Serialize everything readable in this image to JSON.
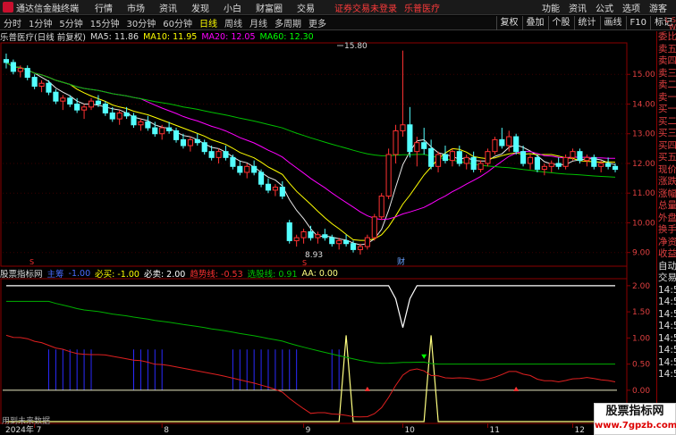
{
  "titlebar": {
    "app_title": "通达信金融终端",
    "menus": [
      "行情",
      "市场",
      "资讯",
      "发现",
      "小白",
      "财富圈",
      "交易"
    ],
    "login_notice": "证券交易未登录",
    "stock_name": "乐普医疗",
    "right_items": [
      "功能",
      "资讯",
      "公式",
      "选项"
    ],
    "user": "游客"
  },
  "toolbar": {
    "periods": [
      "分时",
      "1分钟",
      "5分钟",
      "15分钟",
      "30分钟",
      "60分钟",
      "日线",
      "周线",
      "月线",
      "多周期",
      "更多"
    ],
    "active_period": "日线",
    "buttons": [
      "复权",
      "叠加",
      "个股",
      "统计",
      "画线",
      "F10",
      "标记"
    ]
  },
  "chart_header": {
    "title": "乐普医疗(日线 前复权)",
    "ma5": "MA5: 11.86",
    "ma10": "MA10: 11.95",
    "ma20": "MA20: 12.05",
    "ma60": "MA60: 12.30"
  },
  "indicator_header": {
    "name": "股票指标网",
    "item1": "主筹",
    "item1_val": "-1.00",
    "item2": "必买: -1.00",
    "item3": "必卖: 2.00",
    "item4": "趋势线: -0.53",
    "item5": "选股线: 0.91",
    "item6": "AA: 0.00"
  },
  "price_labels": [
    "15.00",
    "14.00",
    "13.00",
    "12.00",
    "11.00",
    "10.00",
    "9.00"
  ],
  "indicator_labels": [
    "2.00",
    "1.50",
    "1.00",
    "0.50",
    "0.00",
    "-0.50"
  ],
  "annotations": {
    "high": "15.80",
    "low": "8.93",
    "cai": "财",
    "s_marker": "S"
  },
  "date_axis": [
    "2024年",
    "7",
    "8",
    "9",
    "10",
    "11",
    "12"
  ],
  "bottom_label": "用到未来数据",
  "right_panel": {
    "items": [
      "委比",
      "卖五",
      "卖四",
      "卖三",
      "卖二",
      "卖一",
      "买一",
      "买二",
      "买三",
      "买四",
      "买五",
      "现价",
      "涨跌",
      "涨幅",
      "总量",
      "外盘",
      "换手",
      "净资",
      "收益",
      "自动",
      "交易",
      "14:50",
      "14:50",
      "14:50",
      "14:50",
      "14:50",
      "14:50",
      "14:50",
      "14:50"
    ],
    "tag": "L S W"
  },
  "watermark": {
    "line1": "股票指标网",
    "line2": "www.7gpzb.com"
  },
  "chart_data": {
    "type": "line",
    "price_axis": {
      "ylim": [
        8.6,
        16.0
      ],
      "ticks": [
        9,
        10,
        11,
        12,
        13,
        14,
        15
      ]
    },
    "indicator_axis": {
      "ylim": [
        -0.6,
        2.1
      ],
      "ticks": [
        2.0,
        1.5,
        1.0,
        0.5,
        0.0,
        -0.5
      ]
    },
    "candles": [
      [
        15.5,
        15.7,
        15.2,
        15.4
      ],
      [
        15.4,
        15.5,
        15.0,
        15.1
      ],
      [
        15.1,
        15.3,
        14.9,
        15.2
      ],
      [
        15.2,
        15.3,
        14.8,
        14.9
      ],
      [
        14.9,
        15.0,
        14.5,
        14.6
      ],
      [
        14.6,
        14.8,
        14.4,
        14.7
      ],
      [
        14.7,
        14.8,
        14.3,
        14.4
      ],
      [
        14.4,
        14.5,
        14.0,
        14.1
      ],
      [
        14.1,
        14.3,
        13.8,
        14.2
      ],
      [
        14.2,
        14.3,
        13.9,
        14.0
      ],
      [
        14.0,
        14.2,
        13.7,
        13.8
      ],
      [
        13.8,
        14.0,
        13.5,
        13.9
      ],
      [
        13.9,
        14.2,
        13.8,
        14.1
      ],
      [
        14.1,
        14.3,
        13.9,
        14.0
      ],
      [
        14.0,
        14.1,
        13.6,
        13.7
      ],
      [
        13.7,
        13.9,
        13.4,
        13.5
      ],
      [
        13.5,
        13.8,
        13.3,
        13.7
      ],
      [
        13.7,
        13.9,
        13.5,
        13.6
      ],
      [
        13.6,
        13.7,
        13.2,
        13.3
      ],
      [
        13.3,
        13.5,
        13.1,
        13.4
      ],
      [
        13.4,
        13.6,
        13.1,
        13.2
      ],
      [
        13.2,
        13.4,
        12.9,
        13.0
      ],
      [
        13.0,
        13.3,
        12.8,
        13.2
      ],
      [
        13.2,
        13.4,
        13.0,
        13.1
      ],
      [
        13.1,
        13.2,
        12.7,
        12.8
      ],
      [
        12.8,
        13.0,
        12.5,
        12.6
      ],
      [
        12.6,
        12.9,
        12.4,
        12.8
      ],
      [
        12.8,
        13.0,
        12.6,
        12.7
      ],
      [
        12.7,
        12.8,
        12.3,
        12.4
      ],
      [
        12.4,
        12.6,
        12.1,
        12.2
      ],
      [
        12.2,
        12.5,
        12.0,
        12.4
      ],
      [
        12.4,
        12.6,
        12.1,
        12.2
      ],
      [
        12.2,
        12.3,
        11.8,
        11.9
      ],
      [
        11.9,
        12.1,
        11.6,
        11.7
      ],
      [
        11.7,
        12.0,
        11.5,
        11.9
      ],
      [
        11.9,
        12.1,
        11.6,
        11.7
      ],
      [
        11.7,
        11.8,
        11.2,
        11.3
      ],
      [
        11.3,
        11.5,
        11.0,
        11.1
      ],
      [
        11.1,
        11.3,
        10.9,
        11.2
      ],
      [
        11.2,
        11.4,
        10.8,
        10.9
      ],
      [
        10.0,
        10.1,
        9.3,
        9.4
      ],
      [
        9.4,
        9.6,
        9.2,
        9.5
      ],
      [
        9.5,
        9.8,
        9.3,
        9.7
      ],
      [
        9.7,
        9.9,
        9.4,
        9.5
      ],
      [
        9.5,
        9.7,
        9.3,
        9.6
      ],
      [
        9.6,
        9.8,
        9.4,
        9.5
      ],
      [
        9.5,
        9.6,
        9.2,
        9.3
      ],
      [
        9.3,
        9.5,
        9.1,
        9.4
      ],
      [
        9.4,
        9.6,
        9.2,
        9.3
      ],
      [
        9.3,
        9.4,
        9.0,
        9.1
      ],
      [
        9.1,
        9.3,
        8.93,
        9.2
      ],
      [
        9.2,
        9.6,
        9.1,
        9.5
      ],
      [
        9.5,
        10.3,
        9.4,
        10.2
      ],
      [
        10.2,
        11.0,
        10.1,
        10.9
      ],
      [
        10.9,
        12.5,
        10.8,
        12.3
      ],
      [
        12.3,
        13.3,
        12.0,
        13.1
      ],
      [
        13.1,
        15.8,
        12.9,
        13.3
      ],
      [
        13.3,
        13.9,
        12.2,
        12.4
      ],
      [
        12.4,
        12.9,
        11.9,
        12.7
      ],
      [
        12.7,
        13.2,
        12.3,
        12.5
      ],
      [
        12.5,
        12.8,
        11.8,
        11.9
      ],
      [
        11.9,
        12.4,
        11.7,
        12.3
      ],
      [
        12.3,
        12.6,
        12.0,
        12.1
      ],
      [
        12.1,
        12.5,
        11.9,
        12.4
      ],
      [
        12.4,
        12.6,
        11.9,
        12.0
      ],
      [
        12.0,
        12.3,
        11.8,
        12.2
      ],
      [
        12.2,
        12.4,
        11.7,
        11.8
      ],
      [
        11.8,
        12.1,
        11.7,
        12.0
      ],
      [
        12.0,
        12.5,
        11.9,
        12.4
      ],
      [
        12.4,
        12.9,
        12.3,
        12.8
      ],
      [
        12.8,
        13.2,
        12.5,
        12.6
      ],
      [
        12.6,
        13.1,
        12.4,
        12.9
      ],
      [
        12.9,
        13.0,
        12.3,
        12.4
      ],
      [
        12.4,
        12.6,
        11.9,
        12.0
      ],
      [
        12.0,
        12.3,
        11.8,
        12.2
      ],
      [
        12.2,
        12.3,
        11.7,
        11.8
      ],
      [
        11.8,
        12.0,
        11.6,
        11.9
      ],
      [
        11.9,
        12.1,
        11.7,
        12.0
      ],
      [
        12.0,
        12.2,
        11.8,
        11.9
      ],
      [
        11.9,
        12.3,
        11.8,
        12.2
      ],
      [
        12.2,
        12.5,
        12.1,
        12.4
      ],
      [
        12.4,
        12.5,
        12.0,
        12.1
      ],
      [
        12.1,
        12.3,
        11.9,
        12.2
      ],
      [
        12.2,
        12.3,
        11.8,
        11.9
      ],
      [
        11.9,
        12.1,
        11.7,
        12.0
      ],
      [
        12.0,
        12.2,
        11.8,
        11.9
      ],
      [
        11.9,
        12.0,
        11.7,
        11.8
      ]
    ]
  }
}
